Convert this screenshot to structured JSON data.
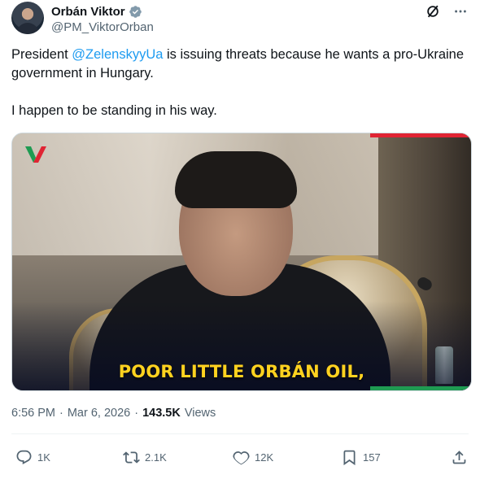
{
  "author": {
    "display_name": "Orbán Viktor",
    "handle": "@PM_ViktorOrban",
    "verified": true
  },
  "header_icons": [
    "grok-icon",
    "more-icon"
  ],
  "tweet": {
    "text_before_mention": "President ",
    "mention": "@ZelenskyyUa",
    "text_after_mention": " is issuing threats because he wants a pro-Ukraine government in Hungary.",
    "second_paragraph": "I happen to be standing in his way."
  },
  "media": {
    "caption": "POOR LITTLE ORBÁN OIL,"
  },
  "meta": {
    "time": "6:56 PM",
    "separator": "·",
    "date": "Mar 6, 2026",
    "views_count": "143.5K",
    "views_label": "Views"
  },
  "actions": {
    "replies": "1K",
    "reposts": "2.1K",
    "likes": "12K",
    "bookmarks": "157"
  },
  "colors": {
    "accent": "#1d9bf0",
    "text": "#0f1419",
    "secondary": "#536471",
    "caption_yellow": "#ffd21f"
  }
}
